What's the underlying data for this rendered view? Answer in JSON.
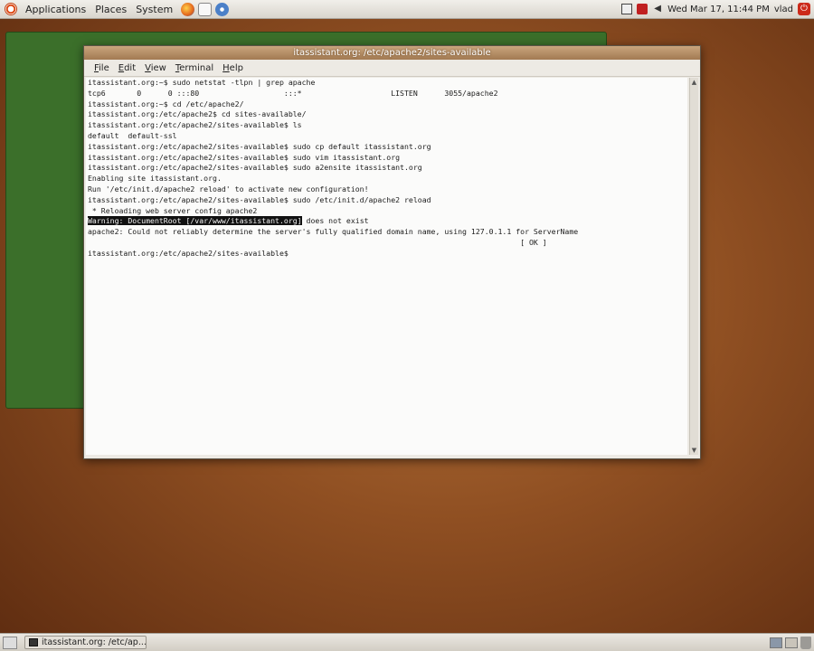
{
  "top_panel": {
    "menus": [
      "Applications",
      "Places",
      "System"
    ],
    "clock": "Wed Mar 17, 11:44 PM",
    "user": "vlad"
  },
  "window": {
    "title": "itassistant.org: /etc/apache2/sites-available",
    "menu": [
      "File",
      "Edit",
      "View",
      "Terminal",
      "Help"
    ]
  },
  "terminal": {
    "lines": [
      "itassistant.org:~$ sudo netstat -tlpn | grep apache",
      "tcp6       0      0 :::80                   :::*                    LISTEN      3055/apache2",
      "itassistant.org:~$ cd /etc/apache2/",
      "itassistant.org:/etc/apache2$ cd sites-available/",
      "itassistant.org:/etc/apache2/sites-available$ ls",
      "default  default-ssl",
      "itassistant.org:/etc/apache2/sites-available$ sudo cp default itassistant.org",
      "itassistant.org:/etc/apache2/sites-available$ sudo vim itassistant.org",
      "itassistant.org:/etc/apache2/sites-available$ sudo a2ensite itassistant.org",
      "Enabling site itassistant.org.",
      "Run '/etc/init.d/apache2 reload' to activate new configuration!",
      "itassistant.org:/etc/apache2/sites-available$ sudo /etc/init.d/apache2 reload",
      " * Reloading web server config apache2"
    ],
    "warning_highlight": "Warning: DocumentRoot [/var/www/itassistant.org]",
    "warning_rest": " does not exist",
    "lines_after": [
      "apache2: Could not reliably determine the server's fully qualified domain name, using 127.0.1.1 for ServerName",
      "                                                                                                 [ OK ]",
      "itassistant.org:/etc/apache2/sites-available$ "
    ]
  },
  "taskbar": {
    "task_label": "itassistant.org: /etc/ap..."
  }
}
